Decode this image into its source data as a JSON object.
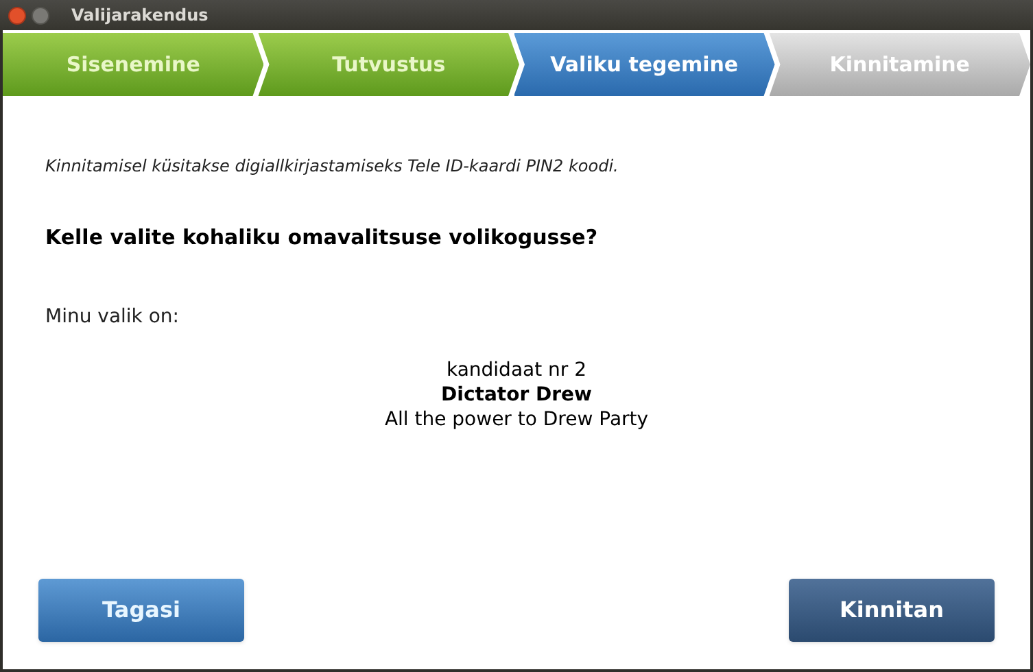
{
  "window": {
    "title": "Valijarakendus"
  },
  "steps": [
    {
      "label": "Sisenemine",
      "kind": "done"
    },
    {
      "label": "Tutvustus",
      "kind": "done"
    },
    {
      "label": "Valiku tegemine",
      "kind": "current"
    },
    {
      "label": "Kinnitamine",
      "kind": "pending"
    }
  ],
  "notice": "Kinnitamisel küsitakse digiallkirjastamiseks Tele ID-kaardi PIN2 koodi.",
  "question": "Kelle valite kohaliku omavalitsuse volikogusse?",
  "choice_label": "Minu valik on:",
  "candidate": {
    "number": "kandidaat nr 2",
    "name": "Dictator Drew",
    "party": "All the power to Drew Party"
  },
  "buttons": [
    {
      "label": "Tagasi",
      "kind": "back"
    },
    {
      "label": "Kinnitan",
      "kind": "confirm"
    }
  ]
}
